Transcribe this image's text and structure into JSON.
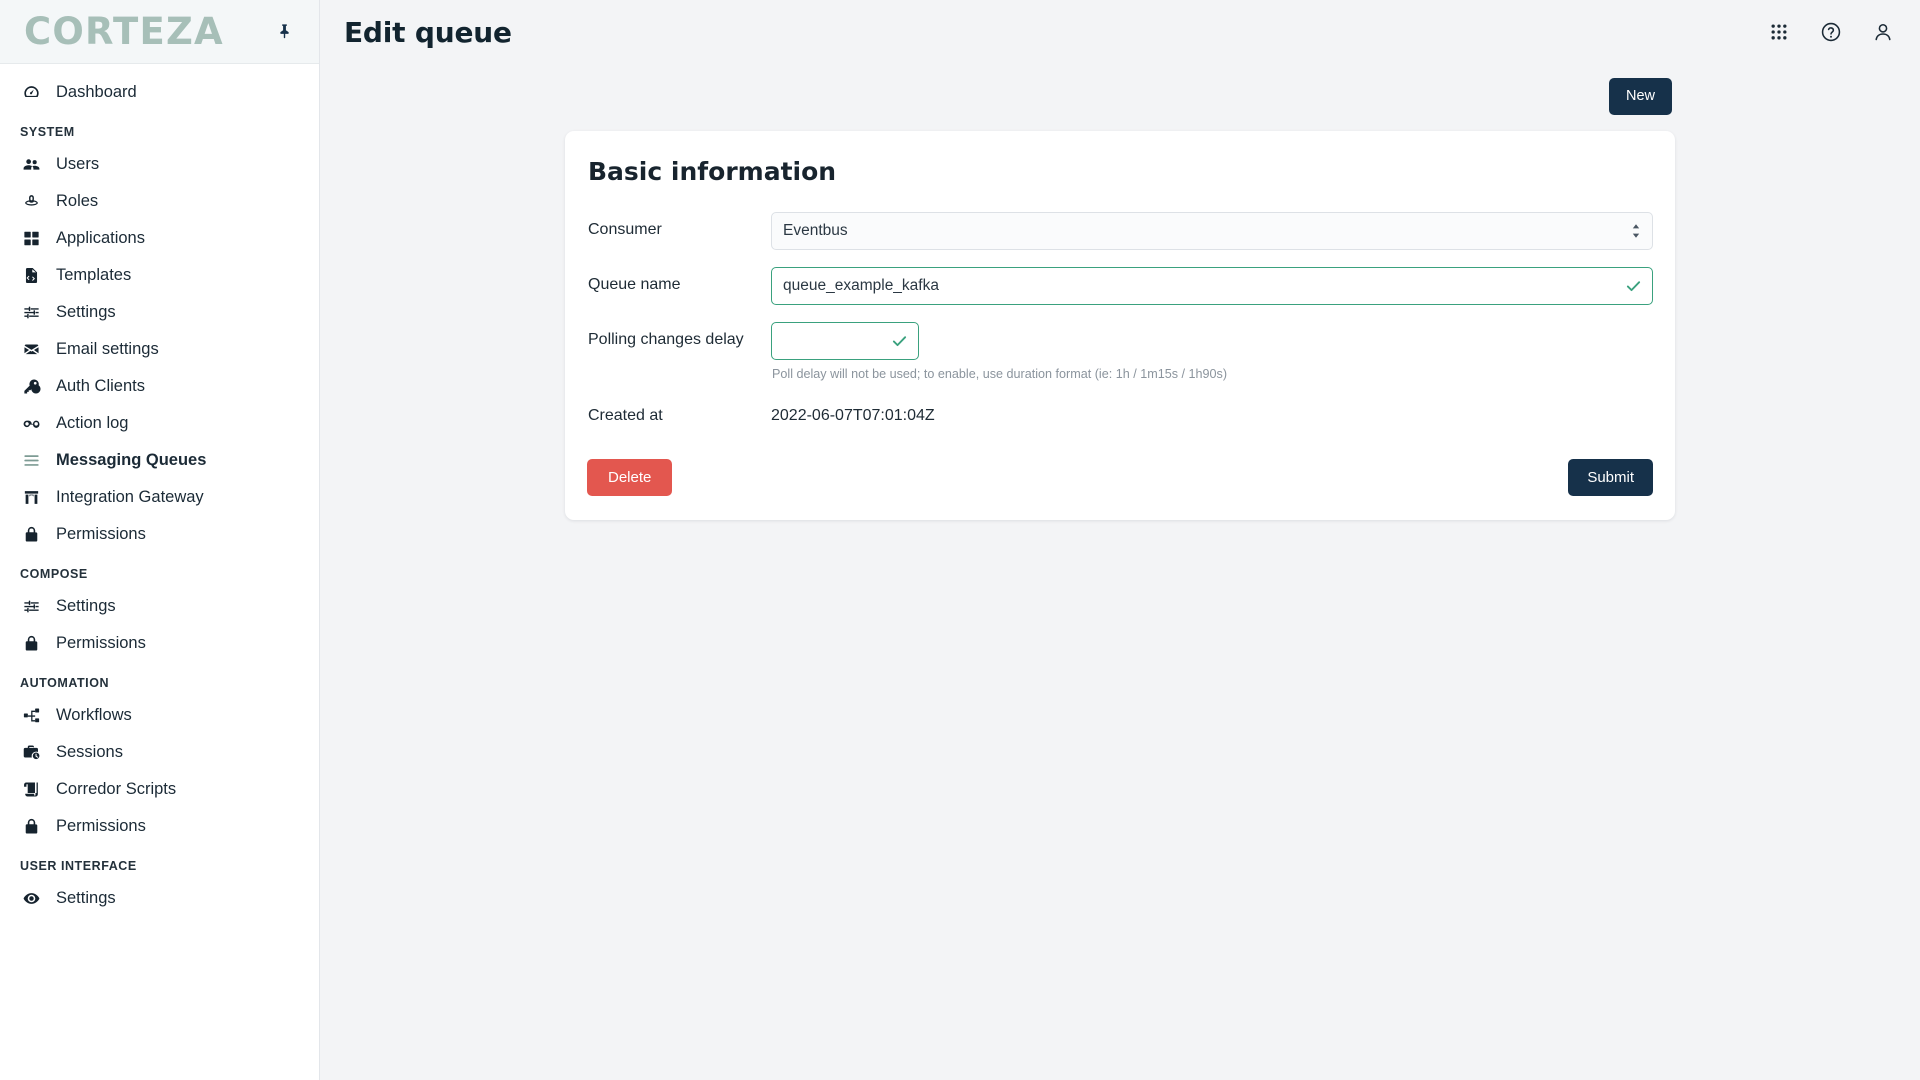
{
  "brand": {
    "logo_text": "CORTEZA",
    "pin_icon": "pin-icon",
    "accent_color": "#a7bfb8"
  },
  "sidebar": {
    "items": [
      {
        "label": "Dashboard",
        "icon": "dashboard-icon",
        "type": "item",
        "active": false
      },
      {
        "label": "SYSTEM",
        "type": "group"
      },
      {
        "label": "Users",
        "icon": "users-icon",
        "type": "item",
        "active": false
      },
      {
        "label": "Roles",
        "icon": "roles-hat-icon",
        "type": "item",
        "active": false
      },
      {
        "label": "Applications",
        "icon": "applications-grid-icon",
        "type": "item",
        "active": false
      },
      {
        "label": "Templates",
        "icon": "templates-file-code-icon",
        "type": "item",
        "active": false
      },
      {
        "label": "Settings",
        "icon": "sliders-icon",
        "type": "item",
        "active": false
      },
      {
        "label": "Email settings",
        "icon": "envelope-icon",
        "type": "item",
        "active": false
      },
      {
        "label": "Auth Clients",
        "icon": "key-icon",
        "type": "item",
        "active": false
      },
      {
        "label": "Action log",
        "icon": "glasses-icon",
        "type": "item",
        "active": false
      },
      {
        "label": "Messaging Queues",
        "icon": "queue-lines-icon",
        "type": "item",
        "active": true
      },
      {
        "label": "Integration Gateway",
        "icon": "gateway-icon",
        "type": "item",
        "active": false
      },
      {
        "label": "Permissions",
        "icon": "lock-icon",
        "type": "item",
        "active": false
      },
      {
        "label": "COMPOSE",
        "type": "group"
      },
      {
        "label": "Settings",
        "icon": "sliders-icon",
        "type": "item",
        "active": false
      },
      {
        "label": "Permissions",
        "icon": "lock-icon",
        "type": "item",
        "active": false
      },
      {
        "label": "AUTOMATION",
        "type": "group"
      },
      {
        "label": "Workflows",
        "icon": "workflow-icon",
        "type": "item",
        "active": false
      },
      {
        "label": "Sessions",
        "icon": "sessions-briefcase-icon",
        "type": "item",
        "active": false
      },
      {
        "label": "Corredor Scripts",
        "icon": "scroll-icon",
        "type": "item",
        "active": false
      },
      {
        "label": "Permissions",
        "icon": "lock-icon",
        "type": "item",
        "active": false
      },
      {
        "label": "USER INTERFACE",
        "type": "group"
      },
      {
        "label": "Settings",
        "icon": "eye-icon",
        "type": "item",
        "active": false
      }
    ]
  },
  "header": {
    "title": "Edit queue",
    "icons": [
      {
        "name": "grid-apps-icon"
      },
      {
        "name": "help-circle-icon"
      },
      {
        "name": "user-account-icon"
      }
    ]
  },
  "toolbar": {
    "new_label": "New"
  },
  "form": {
    "card_title": "Basic information",
    "consumer": {
      "label": "Consumer",
      "value": "Eventbus",
      "options": [
        "Eventbus"
      ]
    },
    "queue_name": {
      "label": "Queue name",
      "value": "queue_example_kafka",
      "valid": true
    },
    "polling_delay": {
      "label": "Polling changes delay",
      "value": "",
      "valid": true,
      "help": "Poll delay will not be used; to enable, use duration format (ie: 1h / 1m15s / 1h90s)"
    },
    "created_at": {
      "label": "Created at",
      "value": "2022-06-07T07:01:04Z"
    },
    "delete_label": "Delete",
    "submit_label": "Submit"
  },
  "colors": {
    "valid_green": "#3aa17e",
    "danger_red": "#e3574f",
    "primary_dark": "#16314a"
  }
}
